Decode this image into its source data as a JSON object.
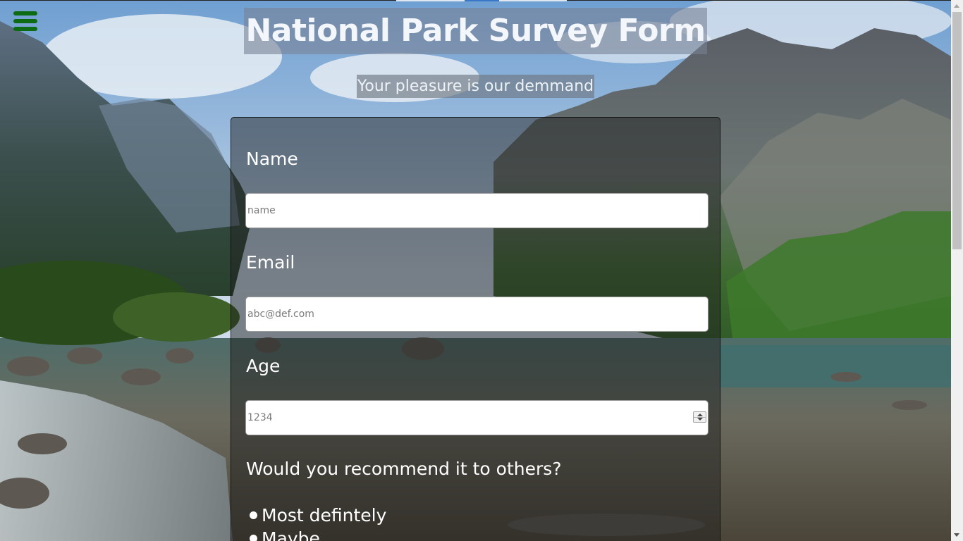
{
  "header": {
    "title": "National Park Survey Form",
    "subtitle": "Your pleasure is our demmand"
  },
  "menu": {
    "icon": "hamburger-menu-icon",
    "color": "#0d6b13"
  },
  "form": {
    "name_label": "Name",
    "name_placeholder": "name",
    "email_label": "Email",
    "email_placeholder": "abc@def.com",
    "age_label": "Age",
    "age_placeholder": "1234",
    "recommend_question": "Would you recommend it to others?",
    "recommend_options": [
      "Most defintely",
      "Maybe"
    ]
  }
}
